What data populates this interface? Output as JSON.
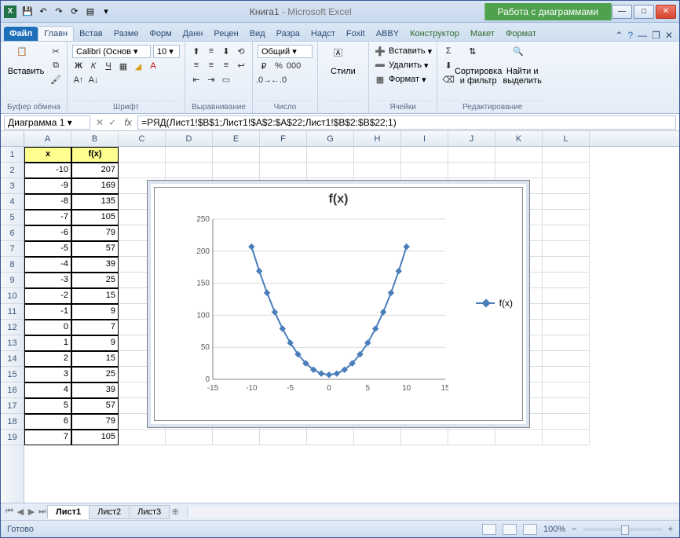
{
  "title": {
    "doc": "Книга1",
    "sep": " - ",
    "app": "Microsoft Excel",
    "chart_tools": "Работа с диаграммами"
  },
  "qat": [
    "save",
    "undo",
    "redo",
    "refresh",
    "print"
  ],
  "tabs": {
    "file": "Файл",
    "home": "Главн",
    "insert": "Встав",
    "page": "Разме",
    "form": "Форм",
    "data": "Данн",
    "review": "Рецен",
    "view": "Вид",
    "dev": "Разра",
    "add": "Надст",
    "foxit": "Foxit",
    "abbyy": "ABBY",
    "design": "Конструктор",
    "layout": "Макет",
    "format": "Формат"
  },
  "ribbon": {
    "clipboard": {
      "paste": "Вставить",
      "label": "Буфер обмена"
    },
    "font": {
      "name": "Calibri (Основ",
      "size": "10",
      "label": "Шрифт"
    },
    "align": {
      "label": "Выравнивание"
    },
    "number": {
      "format": "Общий",
      "label": "Число"
    },
    "styles": {
      "btn": "Стили"
    },
    "cells": {
      "insert": "Вставить",
      "delete": "Удалить",
      "format": "Формат",
      "label": "Ячейки"
    },
    "editing": {
      "sort": "Сортировка\nи фильтр",
      "find": "Найти и\nвыделить",
      "label": "Редактирование"
    }
  },
  "namebox": "Диаграмма 1",
  "formula": "=РЯД(Лист1!$B$1;Лист1!$A$2:$A$22;Лист1!$B$2:$B$22;1)",
  "cols": [
    "A",
    "B",
    "C",
    "D",
    "E",
    "F",
    "G",
    "H",
    "I",
    "J",
    "K",
    "L"
  ],
  "table": {
    "headers": [
      "x",
      "f(x)"
    ],
    "rows": [
      [
        -10,
        207
      ],
      [
        -9,
        169
      ],
      [
        -8,
        135
      ],
      [
        -7,
        105
      ],
      [
        -6,
        79
      ],
      [
        -5,
        57
      ],
      [
        -4,
        39
      ],
      [
        -3,
        25
      ],
      [
        -2,
        15
      ],
      [
        -1,
        9
      ],
      [
        0,
        7
      ],
      [
        1,
        9
      ],
      [
        2,
        15
      ],
      [
        3,
        25
      ],
      [
        4,
        39
      ],
      [
        5,
        57
      ],
      [
        6,
        79
      ],
      [
        7,
        105
      ]
    ]
  },
  "chart_data": {
    "type": "line",
    "title": "f(x)",
    "x": [
      -10,
      -9,
      -8,
      -7,
      -6,
      -5,
      -4,
      -3,
      -2,
      -1,
      0,
      1,
      2,
      3,
      4,
      5,
      6,
      7,
      8,
      9,
      10
    ],
    "values": [
      207,
      169,
      135,
      105,
      79,
      57,
      39,
      25,
      15,
      9,
      7,
      9,
      15,
      25,
      39,
      57,
      79,
      105,
      135,
      169,
      207
    ],
    "xlabel": "",
    "ylabel": "",
    "xlim": [
      -15,
      15
    ],
    "ylim": [
      0,
      250
    ],
    "xticks": [
      -15,
      -10,
      -5,
      0,
      5,
      10,
      15
    ],
    "yticks": [
      0,
      50,
      100,
      150,
      200,
      250
    ],
    "series_name": "f(x)"
  },
  "sheets": {
    "s1": "Лист1",
    "s2": "Лист2",
    "s3": "Лист3"
  },
  "status": {
    "ready": "Готово",
    "zoom": "100%"
  }
}
